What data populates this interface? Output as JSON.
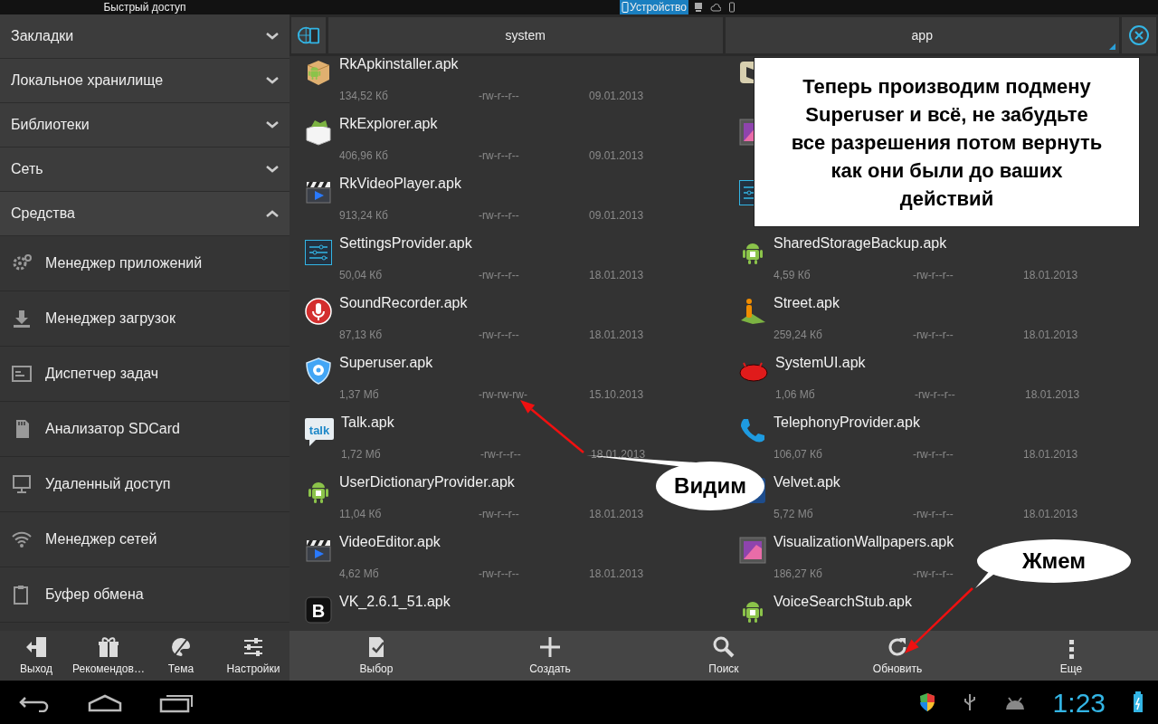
{
  "status_strip": {
    "title": "Быстрый доступ",
    "tabs": [
      {
        "kind": "device",
        "label": "Устройство",
        "selected": true
      },
      {
        "kind": "desktop",
        "selected": false
      },
      {
        "kind": "cloud",
        "selected": false
      },
      {
        "kind": "phone",
        "selected": false
      }
    ]
  },
  "sidebar": {
    "sections": [
      {
        "label": "Закладки",
        "expanded": false
      },
      {
        "label": "Локальное хранилище",
        "expanded": false
      },
      {
        "label": "Библиотеки",
        "expanded": false
      },
      {
        "label": "Сеть",
        "expanded": false
      },
      {
        "label": "Средства",
        "expanded": true
      }
    ],
    "tools": [
      {
        "kind": "gear",
        "label": "Менеджер приложений"
      },
      {
        "kind": "download",
        "label": "Менеджер загрузок"
      },
      {
        "kind": "tasks",
        "label": "Диспетчер задач"
      },
      {
        "kind": "sdcard",
        "label": "Анализатор SDCard"
      },
      {
        "kind": "remote",
        "label": "Удаленный доступ"
      },
      {
        "kind": "wifi",
        "label": "Менеджер сетей"
      },
      {
        "kind": "clipboard",
        "label": "Буфер обмена"
      }
    ]
  },
  "path_bar": {
    "segments": [
      {
        "label": "system"
      },
      {
        "label": "app"
      }
    ]
  },
  "file_columns": [
    {
      "files": [
        {
          "kind": "package",
          "name": "RkApkinstaller.apk",
          "size": "134,52 Кб",
          "permissions": "-rw-r--r--",
          "date": "09.01.2013"
        },
        {
          "kind": "openbox",
          "name": "RkExplorer.apk",
          "size": "406,96 Кб",
          "permissions": "-rw-r--r--",
          "date": "09.01.2013"
        },
        {
          "kind": "clapper",
          "name": "RkVideoPlayer.apk",
          "size": "913,24 Кб",
          "permissions": "-rw-r--r--",
          "date": "09.01.2013"
        },
        {
          "kind": "sliders",
          "name": "SettingsProvider.apk",
          "size": "50,04 Кб",
          "permissions": "-rw-r--r--",
          "date": "18.01.2013"
        },
        {
          "kind": "mic",
          "name": "SoundRecorder.apk",
          "size": "87,13 Кб",
          "permissions": "-rw-r--r--",
          "date": "18.01.2013"
        },
        {
          "kind": "shield",
          "name": "Superuser.apk",
          "size": "1,37 Мб",
          "permissions": "-rw-rw-rw-",
          "date": "15.10.2013"
        },
        {
          "kind": "talk",
          "icon_text": "talk",
          "name": "Talk.apk",
          "size": "1,72 Мб",
          "permissions": "-rw-r--r--",
          "date": "18.01.2013"
        },
        {
          "kind": "android",
          "name": "UserDictionaryProvider.apk",
          "size": "11,04 Кб",
          "permissions": "-rw-r--r--",
          "date": "18.01.2013"
        },
        {
          "kind": "clapper",
          "name": "VideoEditor.apk",
          "size": "4,62 Мб",
          "permissions": "-rw-r--r--",
          "date": "18.01.2013"
        },
        {
          "kind": "tile",
          "icon_text": "B",
          "name": "VK_2.6.1_51.apk"
        }
      ]
    },
    {
      "files": [
        {
          "kind": "book"
        },
        {
          "kind": "picture"
        },
        {
          "kind": "sliders"
        },
        {
          "kind": "android",
          "name": "SharedStorageBackup.apk",
          "size": "4,59 Кб",
          "permissions": "-rw-r--r--",
          "date": "18.01.2013"
        },
        {
          "kind": "person",
          "name": "Street.apk",
          "size": "259,24 Кб",
          "permissions": "-rw-r--r--",
          "date": "18.01.2013"
        },
        {
          "kind": "bean",
          "name": "SystemUI.apk",
          "size": "1,06 Мб",
          "permissions": "-rw-r--r--",
          "date": "18.01.2013"
        },
        {
          "kind": "phone",
          "name": "TelephonyProvider.apk",
          "size": "106,07 Кб",
          "permissions": "-rw-r--r--",
          "date": "18.01.2013"
        },
        {
          "kind": "square",
          "name": "Velvet.apk",
          "size": "5,72 Мб",
          "permissions": "-rw-r--r--",
          "date": "18.01.2013"
        },
        {
          "kind": "picture",
          "name": "VisualizationWallpapers.apk",
          "size": "186,27 Кб",
          "permissions": "-rw-r--r--"
        },
        {
          "kind": "android",
          "name": "VoiceSearchStub.apk"
        }
      ]
    }
  ],
  "bottom_bar": {
    "left": [
      {
        "kind": "exit",
        "label": "Выход"
      },
      {
        "kind": "gift",
        "label": "Рекомендов…"
      },
      {
        "kind": "palette",
        "label": "Тема"
      },
      {
        "kind": "sliders",
        "label": "Настройки"
      }
    ],
    "right": [
      {
        "kind": "select",
        "label": "Выбор"
      },
      {
        "kind": "plus",
        "label": "Создать"
      },
      {
        "kind": "search",
        "label": "Поиск"
      },
      {
        "kind": "refresh",
        "label": "Обновить"
      },
      {
        "kind": "more",
        "label": "Еще"
      }
    ]
  },
  "annotations": [
    {
      "kind": "note",
      "text": "Теперь производим подмену Superuser и всё, не забудьте все разрешения потом вернуть как они были до ваших действий"
    },
    {
      "kind": "bubble",
      "text": "Видим"
    },
    {
      "kind": "arrow"
    },
    {
      "kind": "bubble",
      "text": "Жмем"
    },
    {
      "kind": "arrow"
    }
  ],
  "system_bar": {
    "time": "1:23"
  }
}
